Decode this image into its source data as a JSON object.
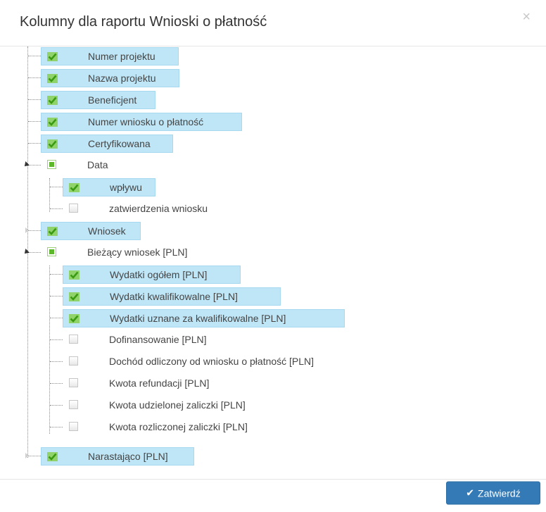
{
  "dialog": {
    "title": "Kolumny dla raportu Wnioski o płatność",
    "close_label": "×",
    "confirm_label": "Zatwierdź",
    "confirm_icon": "✔"
  },
  "columns": {
    "numer_projektu": "Numer projektu",
    "nazwa_projektu": "Nazwa projektu",
    "beneficjent": "Beneficjent",
    "numer_wniosku": "Numer wniosku o płatność",
    "certyfikowana": "Certyfikowana",
    "data": "Data",
    "wplywu": "wpływu",
    "zatwierdzenia_wniosku": "zatwierdzenia wniosku",
    "wniosek": "Wniosek",
    "biezacy_wniosek": "Bieżący wniosek [PLN]",
    "wydatki_ogolem": "Wydatki ogółem [PLN]",
    "wydatki_kwalifikowalne": "Wydatki kwalifikowalne [PLN]",
    "wydatki_uznane": "Wydatki uznane za kwalifikowalne [PLN]",
    "dofinansowanie": "Dofinansowanie [PLN]",
    "dochod_odliczony": "Dochód odliczony od wniosku o płatność [PLN]",
    "kwota_refundacji": "Kwota refundacji [PLN]",
    "kwota_udzielonej_zaliczki": "Kwota udzielonej zaliczki [PLN]",
    "kwota_rozliczonej_zaliczki": "Kwota rozliczonej zaliczki [PLN]",
    "narastajaco": "Narastająco [PLN]"
  },
  "states": {
    "numer_projektu": "checked",
    "nazwa_projektu": "checked",
    "beneficjent": "checked",
    "numer_wniosku": "checked",
    "certyfikowana": "checked",
    "data": "partial",
    "wplywu": "checked",
    "zatwierdzenia_wniosku": "unchecked",
    "wniosek": "checked",
    "biezacy_wniosek": "partial",
    "wydatki_ogolem": "checked",
    "wydatki_kwalifikowalne": "checked",
    "wydatki_uznane": "checked",
    "dofinansowanie": "unchecked",
    "dochod_odliczony": "unchecked",
    "kwota_refundacji": "unchecked",
    "kwota_udzielonej_zaliczki": "unchecked",
    "kwota_rozliczonej_zaliczki": "unchecked",
    "narastajaco": "checked"
  },
  "colors": {
    "selected_bg": "#bfe6f7",
    "check_green": "#5cb82a",
    "button_primary": "#337ab7"
  }
}
